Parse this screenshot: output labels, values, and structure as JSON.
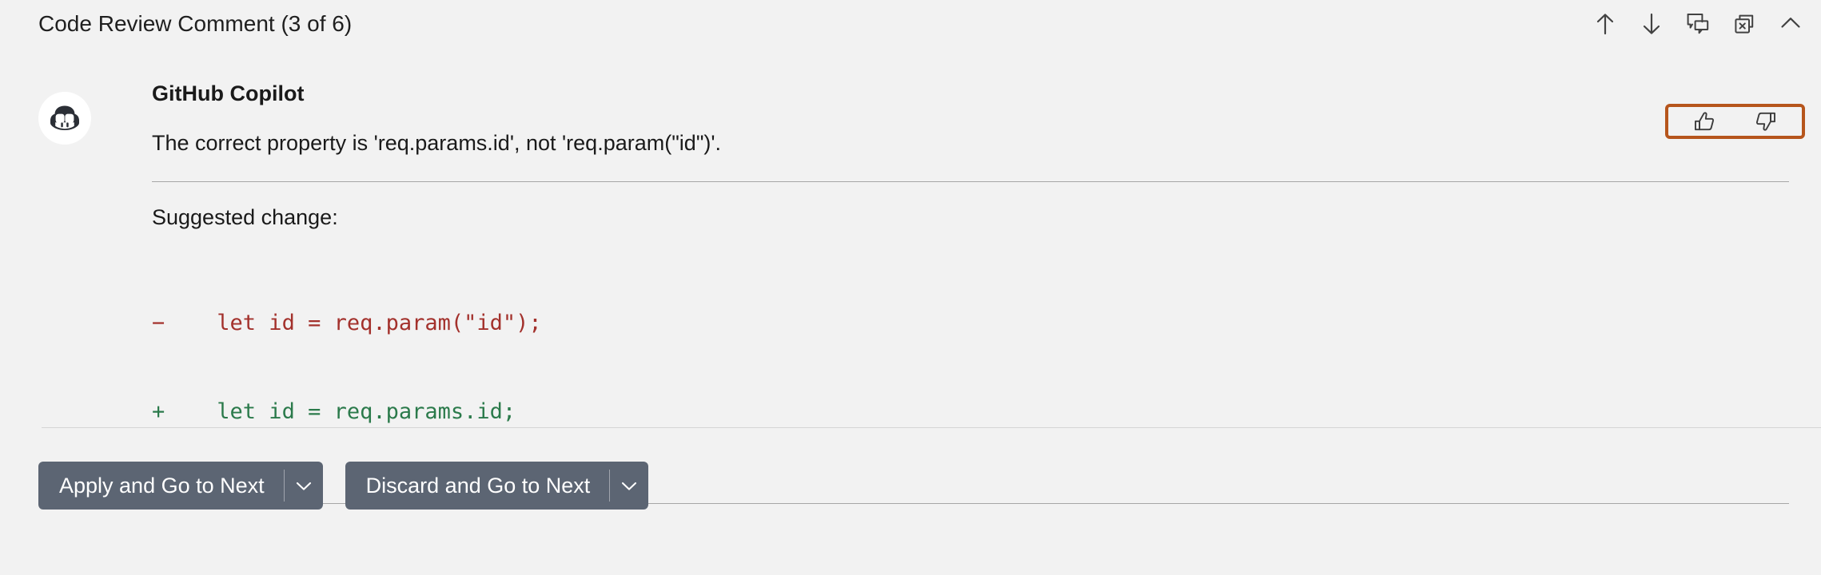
{
  "header": {
    "title": "Code Review Comment (3 of 6)",
    "actions": [
      {
        "name": "previous-comment-button",
        "icon": "arrow-up-icon",
        "tooltip": "Go to Previous Comment"
      },
      {
        "name": "next-comment-button",
        "icon": "arrow-down-icon",
        "tooltip": "Go to Next Comment"
      },
      {
        "name": "view-comments-button",
        "icon": "comments-icon",
        "tooltip": "View Comments"
      },
      {
        "name": "discard-all-button",
        "icon": "close-all-icon",
        "tooltip": "Discard All Comments"
      },
      {
        "name": "collapse-button",
        "icon": "chevron-up-icon",
        "tooltip": "Collapse"
      }
    ]
  },
  "comment": {
    "author": "GitHub Copilot",
    "avatar_icon": "github-copilot-avatar-icon",
    "text": "The correct property is 'req.params.id', not 'req.param(\"id\")'.",
    "suggested_change_label": "Suggested change:",
    "diff": [
      {
        "marker": "−",
        "text": "    let id = req.param(\"id\");",
        "type": "removed"
      },
      {
        "marker": "+",
        "text": "    let id = req.params.id;",
        "type": "added"
      }
    ]
  },
  "feedback": {
    "highlighted": true,
    "highlight_color": "#b6551c",
    "buttons": [
      {
        "name": "thumbs-up-button",
        "icon": "thumbs-up-icon",
        "tooltip": "Helpful"
      },
      {
        "name": "thumbs-down-button",
        "icon": "thumbs-down-icon",
        "tooltip": "Not Helpful"
      }
    ]
  },
  "footer": {
    "primary_button": {
      "label": "Apply and Go to Next",
      "caret_icon": "chevron-down-icon"
    },
    "secondary_button": {
      "label": "Discard and Go to Next",
      "caret_icon": "chevron-down-icon"
    }
  },
  "colors": {
    "background": "#f2f2f2",
    "button": "#5c6573",
    "diff_removed": "#a3312c",
    "diff_added": "#2b7a4b",
    "highlight": "#b6551c",
    "rule": "#a6a6a6"
  }
}
